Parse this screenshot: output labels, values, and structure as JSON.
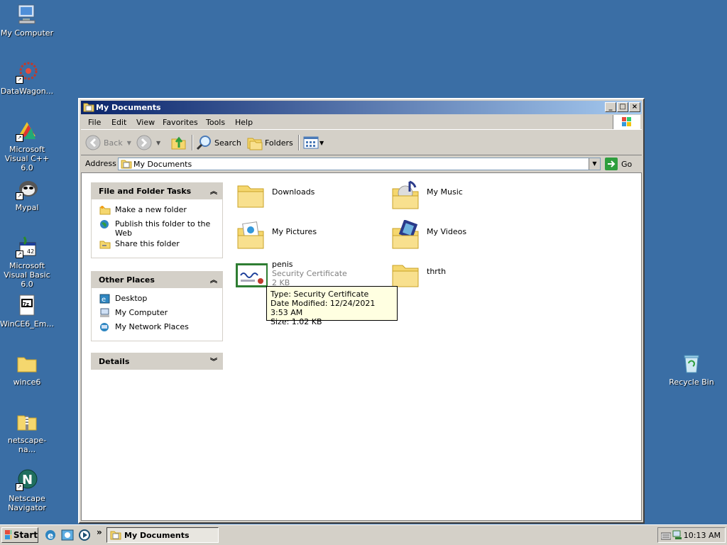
{
  "desktop": {
    "icons": [
      {
        "label": "My Computer",
        "icon": "my-computer-icon"
      },
      {
        "label": "DataWagon...",
        "icon": "datawagon-icon"
      },
      {
        "label": "Microsoft Visual C++ 6.0",
        "icon": "visual-cpp-icon"
      },
      {
        "label": "Mypal",
        "icon": "mypal-icon"
      },
      {
        "label": "Microsoft Visual Basic 6.0",
        "icon": "visual-basic-icon"
      },
      {
        "label": "WinCE6_Em...",
        "icon": "7z-archive-icon"
      },
      {
        "label": "wince6",
        "icon": "folder-icon"
      },
      {
        "label": "netscape-na...",
        "icon": "zip-folder-icon"
      },
      {
        "label": "Netscape Navigator",
        "icon": "netscape-icon"
      },
      {
        "label": "Recycle Bin",
        "icon": "recycle-bin-icon"
      }
    ]
  },
  "window": {
    "title": "My Documents",
    "menu": [
      "File",
      "Edit",
      "View",
      "Favorites",
      "Tools",
      "Help"
    ],
    "toolbar": {
      "back": "Back",
      "search": "Search",
      "folders": "Folders"
    },
    "address": {
      "label": "Address",
      "value": "My Documents",
      "go": "Go"
    },
    "tasks_panel": {
      "title": "File and Folder Tasks",
      "items": [
        "Make a new folder",
        "Publish this folder to the Web",
        "Share this folder"
      ]
    },
    "places_panel": {
      "title": "Other Places",
      "items": [
        "Desktop",
        "My Computer",
        "My Network Places"
      ]
    },
    "details_panel": {
      "title": "Details"
    },
    "items": [
      {
        "name": "Downloads",
        "icon": "folder-icon"
      },
      {
        "name": "My Music",
        "icon": "music-folder-icon"
      },
      {
        "name": "My Pictures",
        "icon": "pictures-folder-icon"
      },
      {
        "name": "My Videos",
        "icon": "videos-folder-icon"
      },
      {
        "name": "penis",
        "type": "Security Certificate",
        "size": "2 KB",
        "icon": "certificate-icon"
      },
      {
        "name": "thrth",
        "icon": "folder-icon"
      }
    ],
    "tooltip": {
      "type": "Type: Security Certificate",
      "modified": "Date Modified: 12/24/2021 3:53 AM",
      "size": "Size: 1.02 KB"
    }
  },
  "taskbar": {
    "start": "Start",
    "task": "My Documents",
    "time": "10:13 AM",
    "overflow": "»"
  },
  "colors": {
    "desktop": "#3a6ea5",
    "titlebar": "#0a246a",
    "tooltip": "#ffffe1"
  }
}
